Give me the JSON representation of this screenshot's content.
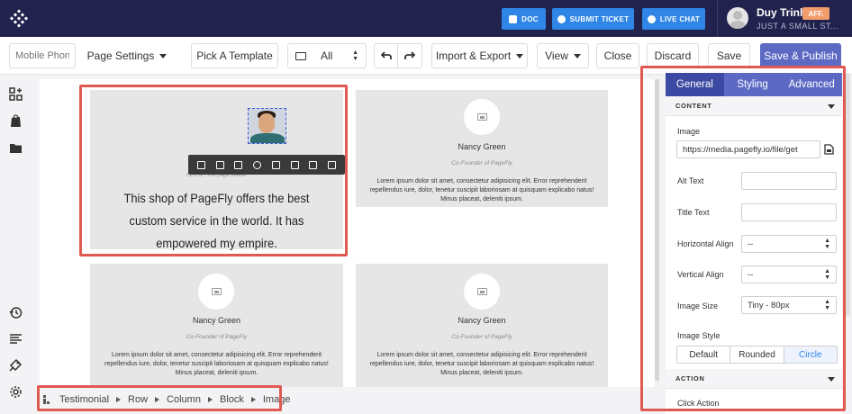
{
  "header": {
    "doc_label": "DOC",
    "submit_ticket_label": "SUBMIT TICKET",
    "live_chat_label": "LIVE CHAT",
    "user_name": "Duy Trinh",
    "aff_badge": "AFF.",
    "store_name": "JUST A SMALL ST..."
  },
  "toolbar": {
    "device_placeholder": "Mobile Phone",
    "page_settings": "Page Settings",
    "pick_template": "Pick A Template",
    "view_filter": "All",
    "import_export": "Import & Export",
    "view": "View",
    "close": "Close",
    "discard": "Discard",
    "save": "Save",
    "save_publish": "Save & Publish"
  },
  "canvas": {
    "selected_quote": "This shop of PageFly offers the best custom service in the world. It has empowered my empire.",
    "selected_caption": "CEO & Flow page builder",
    "cards": [
      {
        "name": "Nancy Green",
        "role": "Co-Founder of PageFly",
        "text": "Lorem ipsum dolor sit amet, consectetur adipisicing elit. Error reprehenderit repellendus iure, dolor, tenetur suscipit laboriosam at quisquam explicabo natus! Minus placeat, deleniti ipsum."
      },
      {
        "name": "Nancy Green",
        "role": "Co-Founder of PageFly",
        "text": "Lorem ipsum dolor sit amet, consectetur adipisicing elit. Error reprehenderit repellendus iure, dolor, tenetur suscipit laboriosam at quisquam explicabo natus! Minus placeat, deleniti ipsum."
      },
      {
        "name": "Nancy Green",
        "role": "Co-Founder of PageFly",
        "text": "Lorem ipsum dolor sit amet, consectetur adipisicing elit. Error reprehenderit repellendus iure, dolor, tenetur suscipit laboriosam at quisquam explicabo natus! Minus placeat, deleniti ipsum."
      }
    ]
  },
  "breadcrumb": {
    "items": [
      "Testimonial",
      "Row",
      "Column",
      "Block",
      "Image"
    ]
  },
  "panel": {
    "tabs": [
      "General",
      "Styling",
      "Advanced"
    ],
    "content_header": "CONTENT",
    "image_label": "Image",
    "image_url": "https://media.pagefly.io/file/get",
    "alt_text_label": "Alt Text",
    "title_text_label": "Title Text",
    "horizontal_align_label": "Horizontal Align",
    "horizontal_align_value": "--",
    "vertical_align_label": "Vertical Align",
    "vertical_align_value": "--",
    "image_size_label": "Image Size",
    "image_size_value": "Tiny - 80px",
    "image_style_label": "Image Style",
    "image_style_options": [
      "Default",
      "Rounded",
      "Circle"
    ],
    "image_style_selected": "Circle",
    "action_header": "ACTION",
    "click_action_label": "Click Action"
  },
  "colors": {
    "header_bg": "#21224d",
    "header_button": "#2f86e6",
    "accent": "#5c6ac4",
    "highlight": "#e05a52",
    "aff_badge": "#f39c6b"
  }
}
